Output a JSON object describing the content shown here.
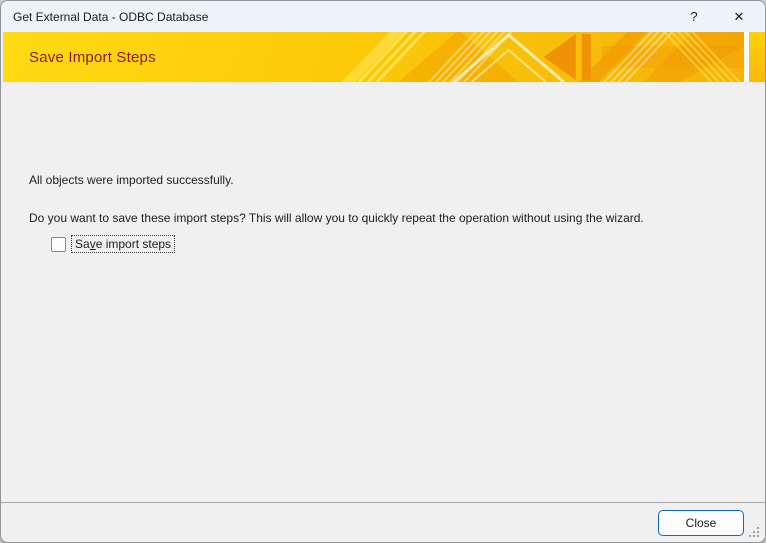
{
  "window": {
    "title": "Get External Data - ODBC Database",
    "help_button": "?",
    "close_button": "✕"
  },
  "banner": {
    "heading": "Save Import Steps"
  },
  "content": {
    "message_success": "All objects were imported successfully.",
    "message_question": "Do you want to save these import steps? This will allow you to quickly repeat the operation without using the wizard.",
    "checkbox": {
      "checked": false,
      "label_pre": "Sa",
      "label_accel": "v",
      "label_post": "e import steps"
    }
  },
  "footer": {
    "close_label": "Close"
  },
  "colors": {
    "titlebar_bg": "#EDF3F9",
    "dialog_bg": "#F0F0F0",
    "banner_gold": "#FCCA08",
    "banner_heading_text": "#8E1B20",
    "accent_blue": "#0F6CBD"
  }
}
